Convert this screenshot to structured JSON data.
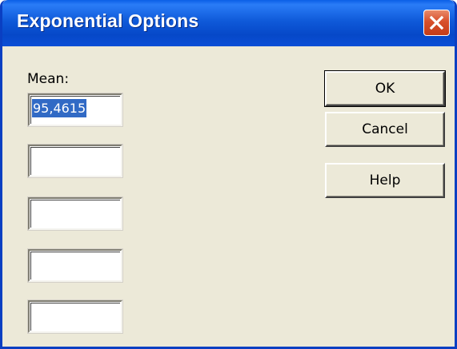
{
  "window": {
    "title": "Exponential Options",
    "close_icon": "close-icon",
    "accent": "#0a5ee7",
    "close_color": "#d8502c"
  },
  "form": {
    "mean_label": "Mean:",
    "fields": [
      {
        "value": "95,4615",
        "selected": true
      },
      {
        "value": ""
      },
      {
        "value": ""
      },
      {
        "value": ""
      },
      {
        "value": ""
      }
    ]
  },
  "buttons": {
    "ok": "OK",
    "cancel": "Cancel",
    "help": "Help"
  }
}
